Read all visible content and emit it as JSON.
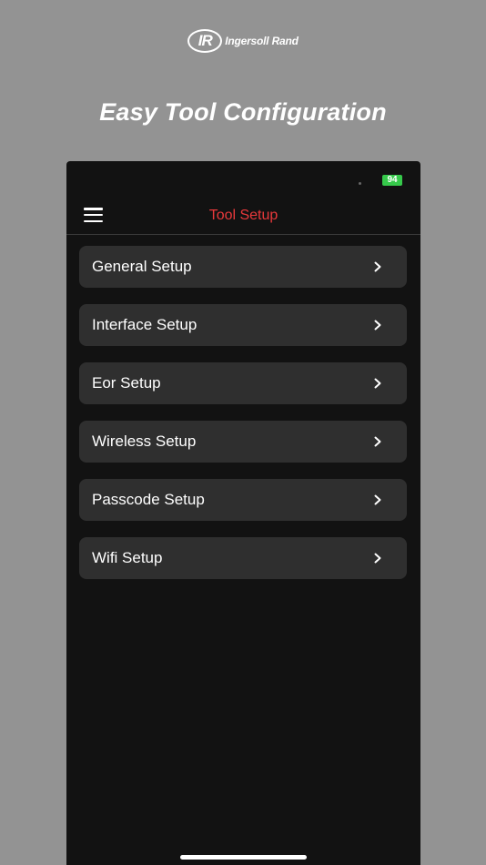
{
  "brand": {
    "mark": "IR",
    "name": "Ingersoll Rand"
  },
  "headline": "Easy Tool Configuration",
  "status_bar": {
    "battery": "94"
  },
  "nav": {
    "title": "Tool Setup"
  },
  "menu_items": [
    {
      "label": "General Setup"
    },
    {
      "label": "Interface Setup"
    },
    {
      "label": "Eor Setup"
    },
    {
      "label": "Wireless Setup"
    },
    {
      "label": "Passcode Setup"
    },
    {
      "label": "Wifi Setup"
    }
  ],
  "colors": {
    "page_background": "#939393",
    "screen_background": "#121212",
    "row_background": "#2f2f2f",
    "title_accent": "#e8393b",
    "battery": "#36c94b"
  },
  "icons": {
    "menu": "hamburger-menu-icon",
    "row_chevron": "chevron-right-icon"
  }
}
